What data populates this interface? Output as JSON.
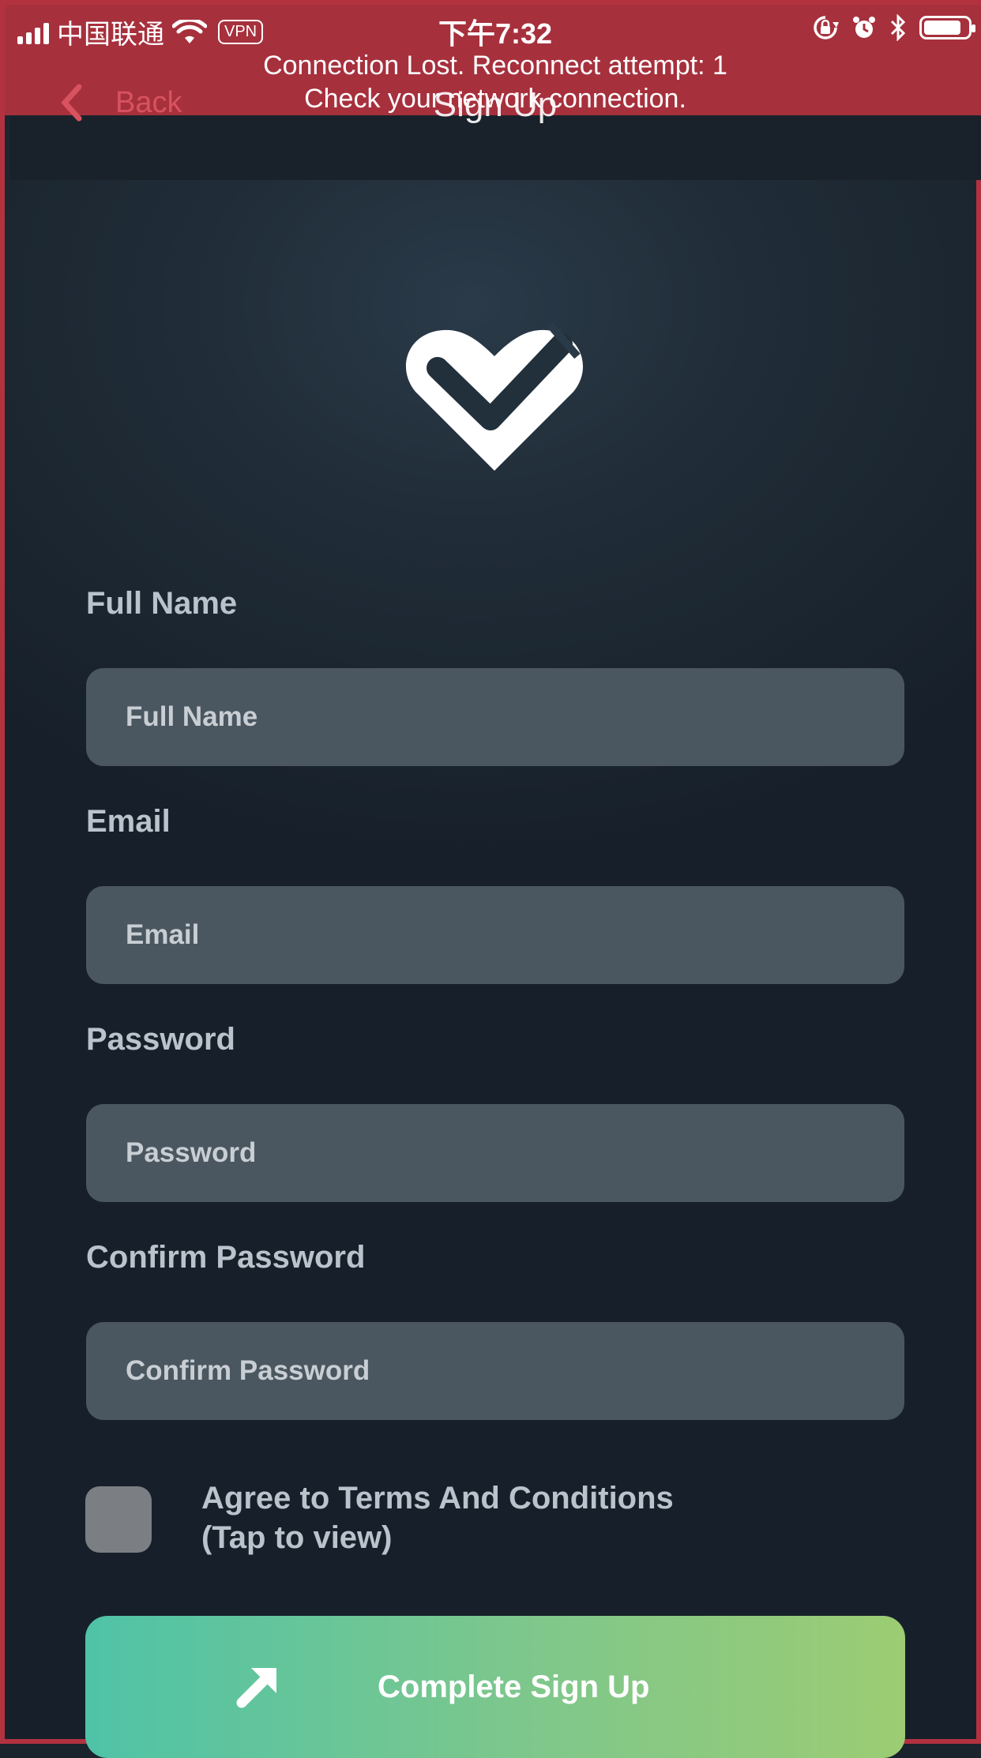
{
  "status_bar": {
    "carrier": "中国联通",
    "vpn": "VPN",
    "time": "下午7:32"
  },
  "connection_banner": {
    "line1": "Connection Lost. Reconnect attempt: 1",
    "line2": "Check your network connection."
  },
  "nav": {
    "back_label": "Back",
    "title": "Sign Up"
  },
  "form": {
    "full_name": {
      "label": "Full Name",
      "placeholder": "Full Name"
    },
    "email": {
      "label": "Email",
      "placeholder": "Email"
    },
    "password": {
      "label": "Password",
      "placeholder": "Password"
    },
    "confirm_password": {
      "label": "Confirm Password",
      "placeholder": "Confirm Password"
    },
    "terms_line1": "Agree to Terms And Conditions",
    "terms_line2": "(Tap to view)",
    "submit_label": "Complete Sign Up"
  },
  "colors": {
    "banner": "#a7303d",
    "back": "#d85260",
    "cta_start": "#4fc3a7",
    "cta_end": "#9ccc73"
  },
  "icons": [
    "signal-icon",
    "wifi-icon",
    "orientation-lock-icon",
    "alarm-icon",
    "bluetooth-icon",
    "battery-icon",
    "chevron-left-icon",
    "heart-check-logo",
    "arrow-up-right-icon"
  ]
}
